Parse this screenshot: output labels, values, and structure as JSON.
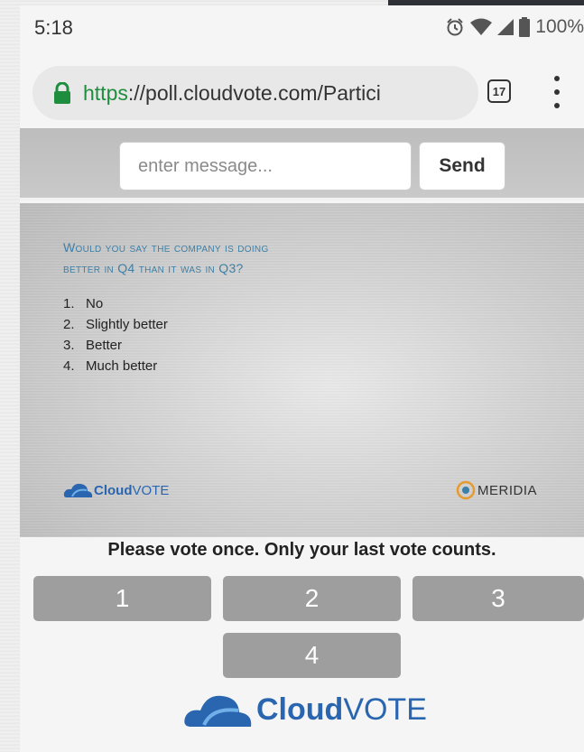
{
  "status_bar": {
    "time": "5:18",
    "battery": "100%",
    "icons": [
      "alarm-icon",
      "wifi-icon",
      "signal-icon",
      "battery-icon"
    ]
  },
  "browser": {
    "url_scheme": "https",
    "url_rest": "://poll.cloudvote.com/Partici",
    "tab_count": "17",
    "icons": [
      "lock-icon",
      "tabs-icon",
      "menu-icon"
    ]
  },
  "message": {
    "placeholder": "enter message...",
    "send_label": "Send"
  },
  "slide": {
    "question_line1": "Would you say the company is doing",
    "question_line2": "better in Q4 than it was in Q3?",
    "options": [
      {
        "num": "1.",
        "text": "No"
      },
      {
        "num": "2.",
        "text": "Slightly better"
      },
      {
        "num": "3.",
        "text": "Better"
      },
      {
        "num": "4.",
        "text": "Much better"
      }
    ],
    "logo_left_bold": "Cloud",
    "logo_left_light": "VOTE",
    "logo_right": "MERIDIA"
  },
  "instruction": "Please vote once. Only your last vote counts.",
  "vote_buttons": [
    "1",
    "2",
    "3",
    "4"
  ],
  "footer_logo": {
    "bold": "Cloud",
    "light": "VOTE"
  },
  "colors": {
    "url_scheme": "#1e8e3e",
    "question": "#3d7fa6",
    "brand_blue": "#2a66b0",
    "vote_button": "#9e9e9e"
  }
}
